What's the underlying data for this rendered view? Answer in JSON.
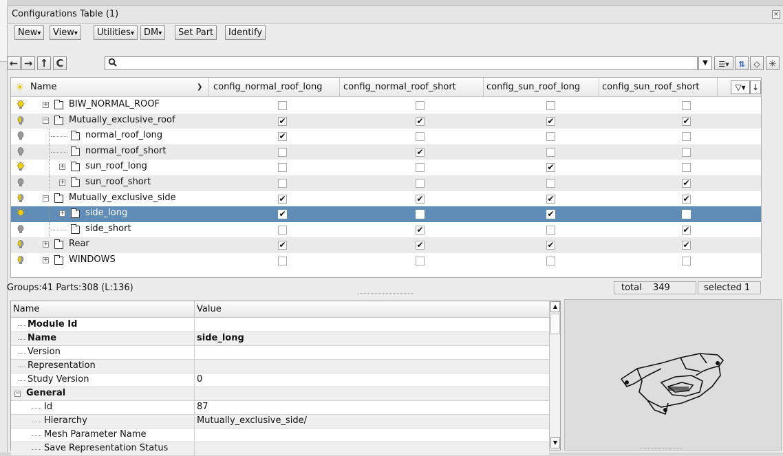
{
  "window": {
    "title": "Configurations Table (1)",
    "close": "×"
  },
  "menu": [
    {
      "label": "New",
      "arrow": true
    },
    {
      "label": "View",
      "arrow": true
    },
    {
      "label": "Utilities",
      "arrow": true
    },
    {
      "label": "DM",
      "arrow": true
    },
    {
      "label": "Set Part",
      "arrow": false
    },
    {
      "label": "Identify",
      "arrow": false
    }
  ],
  "nav": {
    "back": "←",
    "forward": "→",
    "up": "↑",
    "refresh": "C",
    "search_value": "",
    "search_icon": "search-icon"
  },
  "table": {
    "columns": [
      "Name",
      "config_normal_roof_long",
      "config_normal_roof_short",
      "config_sun_roof_long",
      "config_sun_roof_short"
    ],
    "rows": [
      {
        "name": "BIW_NORMAL_ROOF",
        "level": 0,
        "expander": "+",
        "bulb": "on",
        "checks": [
          false,
          false,
          false,
          false
        ]
      },
      {
        "name": "Mutually_exclusive_roof",
        "level": 0,
        "expander": "-",
        "bulb": "half",
        "checks": [
          true,
          true,
          true,
          true
        ]
      },
      {
        "name": "normal_roof_long",
        "level": 1,
        "expander": "",
        "bulb": "off",
        "checks": [
          true,
          false,
          false,
          false
        ]
      },
      {
        "name": "normal_roof_short",
        "level": 1,
        "expander": "",
        "bulb": "off",
        "checks": [
          false,
          true,
          false,
          false
        ]
      },
      {
        "name": "sun_roof_long",
        "level": 1,
        "expander": "+",
        "bulb": "on",
        "checks": [
          false,
          false,
          true,
          false
        ]
      },
      {
        "name": "sun_roof_short",
        "level": 1,
        "expander": "+",
        "bulb": "off",
        "checks": [
          false,
          false,
          false,
          true
        ]
      },
      {
        "name": "Mutually_exclusive_side",
        "level": 0,
        "expander": "-",
        "bulb": "half",
        "checks": [
          true,
          true,
          true,
          true
        ]
      },
      {
        "name": "side_long",
        "level": 1,
        "expander": "+",
        "bulb": "on",
        "checks": [
          true,
          false,
          true,
          false
        ],
        "selected": true
      },
      {
        "name": "side_short",
        "level": 1,
        "expander": "",
        "bulb": "off",
        "checks": [
          false,
          true,
          false,
          true
        ]
      },
      {
        "name": "Rear",
        "level": 0,
        "expander": "+",
        "bulb": "half",
        "checks": [
          true,
          true,
          true,
          true
        ]
      },
      {
        "name": "WINDOWS",
        "level": 0,
        "expander": "+",
        "bulb": "half",
        "checks": [
          false,
          false,
          false,
          false
        ]
      }
    ]
  },
  "status": {
    "left": "Groups:41 Parts:308 (L:136)",
    "total_label": "total",
    "total_value": "349",
    "selected": "selected 1"
  },
  "props": {
    "headers": [
      "Name",
      "Value"
    ],
    "rows": [
      {
        "key": "Module Id",
        "value": "",
        "bold": true,
        "indent": 1
      },
      {
        "key": "Name",
        "value": "side_long",
        "bold": true,
        "indent": 1
      },
      {
        "key": "Version",
        "value": "",
        "bold": false,
        "indent": 1
      },
      {
        "key": "Representation",
        "value": "",
        "bold": false,
        "indent": 1
      },
      {
        "key": "Study Version",
        "value": "0",
        "bold": false,
        "indent": 1
      },
      {
        "key": "General",
        "value": "",
        "bold": true,
        "indent": 0,
        "expander": "-"
      },
      {
        "key": "Id",
        "value": "87",
        "bold": false,
        "indent": 2
      },
      {
        "key": "Hierarchy",
        "value": "Mutually_exclusive_side/",
        "bold": false,
        "indent": 2
      },
      {
        "key": "Mesh Parameter Name",
        "value": "",
        "bold": false,
        "indent": 2
      },
      {
        "key": "Save Representation Status",
        "value": "",
        "bold": false,
        "indent": 2
      }
    ]
  },
  "colors": {
    "selection": "#5f8db8",
    "bulb_on": "#f0d000",
    "bulb_off": "#999999"
  }
}
